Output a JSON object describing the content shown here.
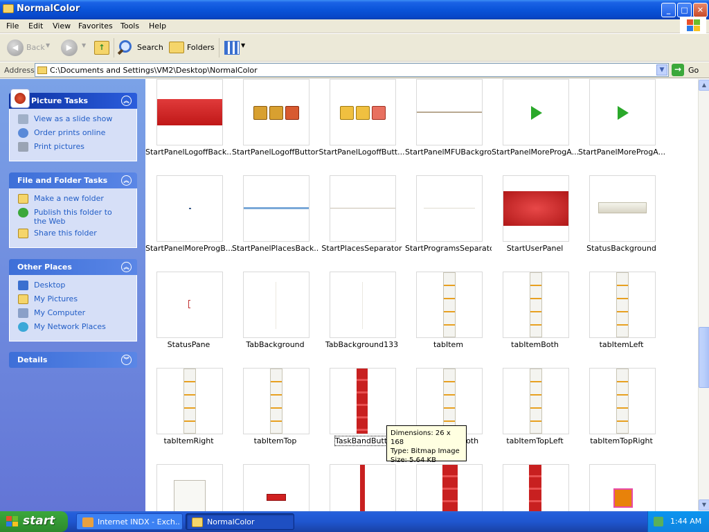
{
  "window": {
    "title": "NormalColor"
  },
  "menubar": {
    "items": [
      "File",
      "Edit",
      "View",
      "Favorites",
      "Tools",
      "Help"
    ]
  },
  "toolbar": {
    "back_label": "Back",
    "search_label": "Search",
    "folders_label": "Folders",
    "back_icon": "back-arrow-icon",
    "forward_icon": "forward-arrow-icon",
    "up_icon": "up-folder-icon",
    "views_icon": "views-grid-icon"
  },
  "address": {
    "label": "Address",
    "path": "C:\\Documents and Settings\\VM2\\Desktop\\NormalColor",
    "go_label": "Go"
  },
  "taskpane": {
    "picture_tasks": {
      "title": "Picture Tasks",
      "items": [
        "View as a slide show",
        "Order prints online",
        "Print pictures"
      ]
    },
    "file_folder_tasks": {
      "title": "File and Folder Tasks",
      "items": [
        "Make a new folder",
        "Publish this folder to the Web",
        "Share this folder"
      ]
    },
    "other_places": {
      "title": "Other Places",
      "items": [
        "Desktop",
        "My Pictures",
        "My Computer",
        "My Network Places"
      ]
    },
    "details": {
      "title": "Details"
    }
  },
  "files": {
    "row1": [
      "StartPanelLogoffBack...",
      "StartPanelLogoffButtons",
      "StartPanelLogoffButt...",
      "StartPanelMFUBackgro...",
      "StartPanelMoreProgA...",
      "StartPanelMoreProgA..."
    ],
    "row2": [
      "StartPanelMoreProgB...",
      "StartPanelPlacesBack...",
      "StartPlacesSeparator",
      "StartProgramsSeparator",
      "StartUserPanel",
      "StatusBackground"
    ],
    "row3": [
      "StatusPane",
      "TabBackground",
      "TabBackground133",
      "tabItem",
      "tabItemBoth",
      "tabItemLeft"
    ],
    "row4": [
      "tabItemRight",
      "tabItemTop",
      "TaskBandButton",
      "tabItemTopBoth",
      "tabItemTopLeft",
      "tabItemTopRight"
    ]
  },
  "tooltip": {
    "dimensions": "Dimensions: 26 x 168",
    "type": "Type: Bitmap Image",
    "size": "Size: 5.64 KB"
  },
  "taskbar": {
    "start_label": "start",
    "items": [
      "Internet INDX - Exch...",
      "NormalColor"
    ],
    "clock": "1:44 AM"
  },
  "colors": {
    "titlebar": "#0a54d9",
    "taskpane": "#6375d6",
    "link": "#215dc6",
    "start": "#3ca83c"
  }
}
